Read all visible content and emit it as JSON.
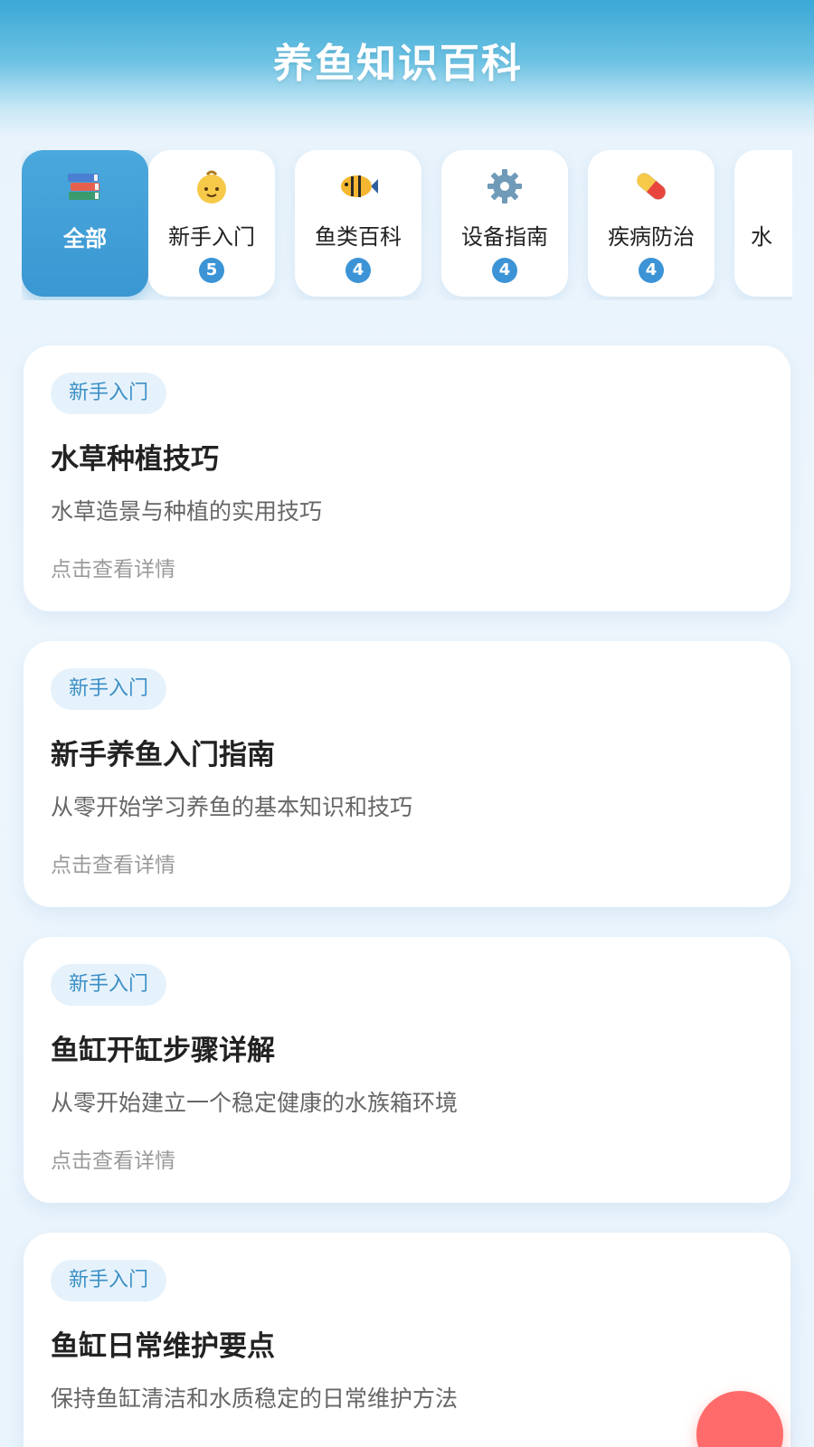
{
  "header": {
    "title": "养鱼知识百科"
  },
  "categories": [
    {
      "label": "全部",
      "icon": "books-icon",
      "count": ""
    },
    {
      "label": "新手入门",
      "icon": "baby-icon",
      "count": "5"
    },
    {
      "label": "鱼类百科",
      "icon": "tropical-fish-icon",
      "count": "4"
    },
    {
      "label": "设备指南",
      "icon": "gear-icon",
      "count": "4"
    },
    {
      "label": "疾病防治",
      "icon": "pill-icon",
      "count": "4"
    },
    {
      "label": "水",
      "icon": "",
      "count": ""
    }
  ],
  "articles": [
    {
      "tag": "新手入门",
      "title": "水草种植技巧",
      "desc": "水草造景与种植的实用技巧",
      "more": "点击查看详情"
    },
    {
      "tag": "新手入门",
      "title": "新手养鱼入门指南",
      "desc": "从零开始学习养鱼的基本知识和技巧",
      "more": "点击查看详情"
    },
    {
      "tag": "新手入门",
      "title": "鱼缸开缸步骤详解",
      "desc": "从零开始建立一个稳定健康的水族箱环境",
      "more": "点击查看详情"
    },
    {
      "tag": "新手入门",
      "title": "鱼缸日常维护要点",
      "desc": "保持鱼缸清洁和水质稳定的日常维护方法",
      "more": ""
    }
  ],
  "colors": {
    "accent": "#3c94d6",
    "fab": "#ff6b6b",
    "tag_bg": "#e6f2fb",
    "tag_text": "#3b8fc6"
  }
}
